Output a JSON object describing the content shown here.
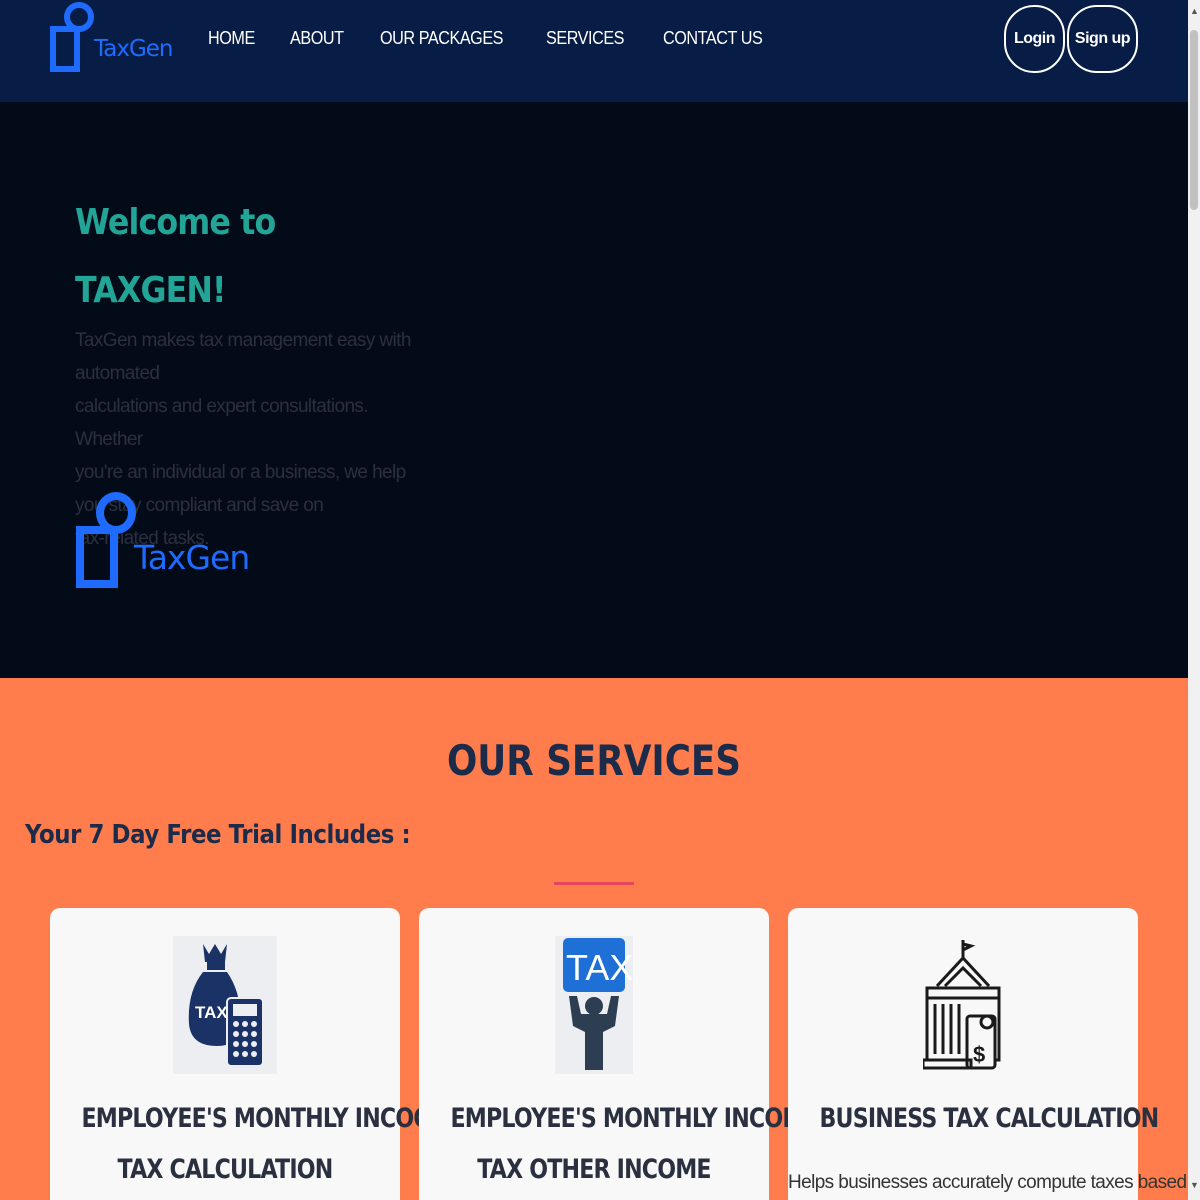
{
  "brand": {
    "name": "TaxGen",
    "color": "#1f6bff"
  },
  "nav": {
    "links": [
      "HOME",
      "ABOUT",
      "OUR PACKAGES",
      "SERVICES",
      "CONTACT US"
    ],
    "login": "Login",
    "signup": "Sign up"
  },
  "hero": {
    "welcome": "Welcome to",
    "title": "TAXGEN!",
    "lines": [
      "TaxGen makes tax management easy with automated",
      "calculations and expert consultations. Whether",
      "you're an individual or a business, we help",
      "you stay compliant and save on",
      "tax-related tasks."
    ]
  },
  "services": {
    "heading": "OUR SERVICES",
    "trial": "Your 7 Day Free Trial Includes :",
    "cards": [
      {
        "icon": "tax-bag-calculator-icon",
        "line1": "EMPLOYEE'S MONTHLY INCOOME",
        "line2": "TAX CALCULATION",
        "desc": ""
      },
      {
        "icon": "tax-person-icon",
        "line1": "EMPLOYEE'S MONTHLY INCOME",
        "line2": "TAX OTHER INCOME",
        "desc": ""
      },
      {
        "icon": "government-building-icon",
        "line1": "BUSINESS TAX CALCULATION",
        "line2": "",
        "desc": "Helps businesses accurately compute taxes based"
      }
    ]
  },
  "colors": {
    "nav_bg": "#071d45",
    "hero_bg": "#030b18",
    "accent_teal": "#22a596",
    "section_bg": "#ff7d4c",
    "heading_navy": "#1c2b4a",
    "divider": "#e6455d"
  }
}
